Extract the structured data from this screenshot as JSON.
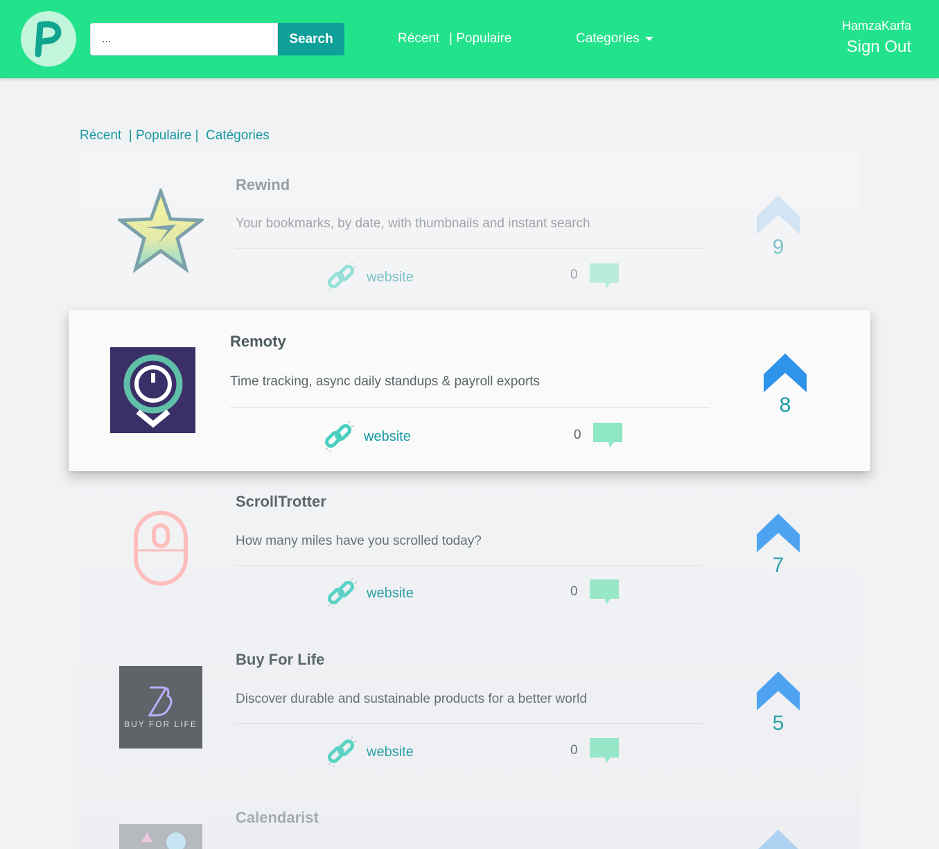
{
  "header": {
    "search": {
      "placeholder": "...",
      "value": "...",
      "button_label": "Search"
    },
    "nav": {
      "recent": "Récent",
      "popular": "| Populaire",
      "categories": "Categories"
    },
    "user": {
      "name": "HamzaKarfa",
      "signout": "Sign Out"
    }
  },
  "subnav": {
    "recent": "Récent",
    "popular": "| Populaire |",
    "categories": "Catégories"
  },
  "products": [
    {
      "title": "Rewind",
      "description": "Your bookmarks, by date, with thumbnails and instant search",
      "link_label": "website",
      "comments": "0",
      "votes": "9",
      "icon": "star-rewind-logo"
    },
    {
      "title": "Remoty",
      "description": "Time tracking, async daily standups & payroll exports",
      "link_label": "website",
      "comments": "0",
      "votes": "8",
      "icon": "remoty-logo"
    },
    {
      "title": "ScrollTrotter",
      "description": "How many miles have you scrolled today?",
      "link_label": "website",
      "comments": "0",
      "votes": "7",
      "icon": "mouse-logo"
    },
    {
      "title": "Buy For Life",
      "description": "Discover durable and sustainable products for a better world",
      "link_label": "website",
      "comments": "0",
      "votes": "5",
      "icon": "buy-for-life-logo",
      "logo_text": "BUY FOR LIFE"
    },
    {
      "title": "Calendarist",
      "icon": "calendarist-logo"
    }
  ],
  "colors": {
    "navbar": "#22e28b",
    "accent": "#1a9aa3",
    "search_button": "#10a09a",
    "upvote": "#3d9bf0",
    "comment": "#8ee6c4"
  }
}
